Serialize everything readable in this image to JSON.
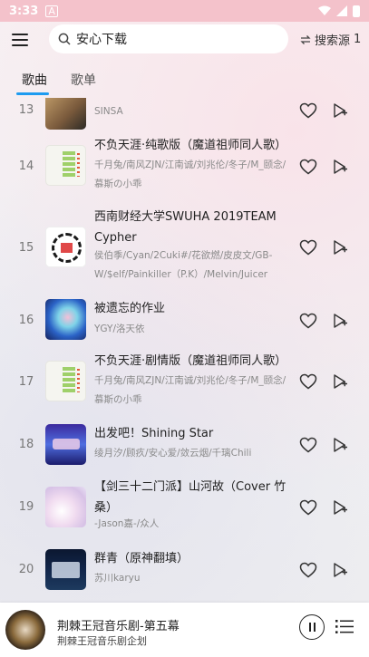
{
  "status": {
    "time": "3:33",
    "a_icon": "A"
  },
  "header": {
    "menu_icon": "menu-icon",
    "search": {
      "value": "安心下载"
    },
    "source": {
      "label": "搜索源",
      "number": "1"
    }
  },
  "tabs": [
    {
      "label": "歌曲",
      "active": true
    },
    {
      "label": "歌单",
      "active": false
    }
  ],
  "songs": [
    {
      "num": "13",
      "title": "",
      "artist": "SINSA"
    },
    {
      "num": "14",
      "title": "不负天涯·纯歌版（魔道祖师同人歌）",
      "artist": "千月兔/南风ZJN/江南诚/刘兆伦/冬子/M_颐念/慕斯の小乖"
    },
    {
      "num": "15",
      "title": "西南财经大学SWUHA 2019TEAM Cypher",
      "artist": "侯伯季/Cyan/2Cuki#/花欲燃/皮皮文/GB-W/$elf/Painkiller（P.K）/Melvin/Juicer"
    },
    {
      "num": "16",
      "title": "被遗忘的作业",
      "artist": "YGY/洛天依"
    },
    {
      "num": "17",
      "title": "不负天涯·剧情版（魔道祖师同人歌）",
      "artist": "千月兔/南风ZJN/江南诚/刘兆伦/冬子/M_颐念/慕斯の小乖"
    },
    {
      "num": "18",
      "title": "出发吧！Shining Star",
      "artist": "绫月汐/顾疚/安心爱/敛云烟/千璃Chili"
    },
    {
      "num": "19",
      "title": "【剑三十二门派】山河故（Cover 竹桑）",
      "artist": "-Jason嘉-/众人"
    },
    {
      "num": "20",
      "title": "群青（原神翻填）",
      "artist": "苏川karyu"
    }
  ],
  "player": {
    "title": "荆棘王冠音乐剧-第五幕",
    "subtitle": "荆棘王冠音乐剧企划"
  },
  "colors": {
    "status_bar": "#f4c2cb",
    "accent": "#1d9bf0"
  }
}
